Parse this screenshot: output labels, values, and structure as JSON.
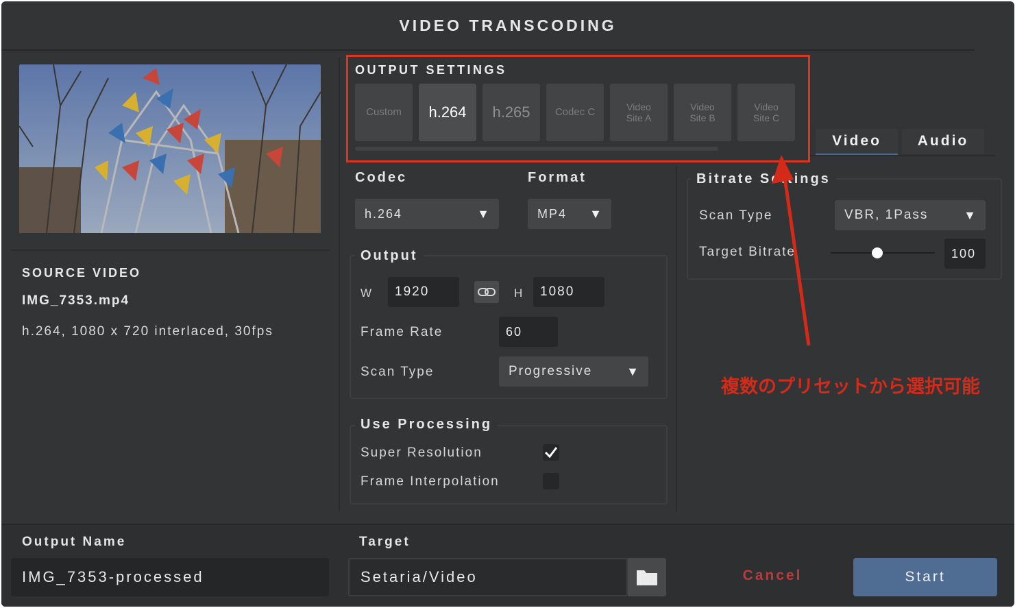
{
  "window": {
    "title": "VIDEO TRANSCODING"
  },
  "source": {
    "heading": "SOURCE VIDEO",
    "filename": "IMG_7353.mp4",
    "info": "h.264, 1080 x 720 interlaced, 30fps"
  },
  "presets": {
    "title": "OUTPUT SETTINGS",
    "items": [
      {
        "label": "Custom",
        "active": false
      },
      {
        "label": "h.264",
        "active": true
      },
      {
        "label": "h.265",
        "active": false
      },
      {
        "label": "Codec C",
        "active": false
      },
      {
        "label": "Video Site A",
        "active": false
      },
      {
        "label": "Video Site B",
        "active": false
      },
      {
        "label": "Video Site C",
        "active": false
      }
    ]
  },
  "codec": {
    "label": "Codec",
    "value": "h.264"
  },
  "format": {
    "label": "Format",
    "value": "MP4"
  },
  "output": {
    "title": "Output",
    "w_label": "W",
    "width": "1920",
    "h_label": "H",
    "height": "1080",
    "frame_rate_label": "Frame Rate",
    "frame_rate": "60",
    "scan_type_label": "Scan Type",
    "scan_type": "Progressive"
  },
  "processing": {
    "title": "Use Processing",
    "super_resolution_label": "Super Resolution",
    "super_resolution": true,
    "frame_interpolation_label": "Frame Interpolation",
    "frame_interpolation": false
  },
  "tabs": {
    "video": "Video",
    "audio": "Audio",
    "active": "Video"
  },
  "bitrate": {
    "title": "Bitrate Settings",
    "scan_type_label": "Scan Type",
    "scan_type": "VBR, 1Pass",
    "target_label": "Target Bitrate",
    "target_value": "100",
    "slider_fraction": 0.45
  },
  "annotation": "複数のプリセットから選択可能",
  "bottom": {
    "output_name_label": "Output Name",
    "output_name": "IMG_7353-processed",
    "target_label": "Target",
    "target": "Setaria/Video",
    "cancel": "Cancel",
    "start": "Start"
  },
  "colors": {
    "accent": "#4f6d93",
    "cancel": "#c0393a",
    "highlight": "#e1341e"
  }
}
